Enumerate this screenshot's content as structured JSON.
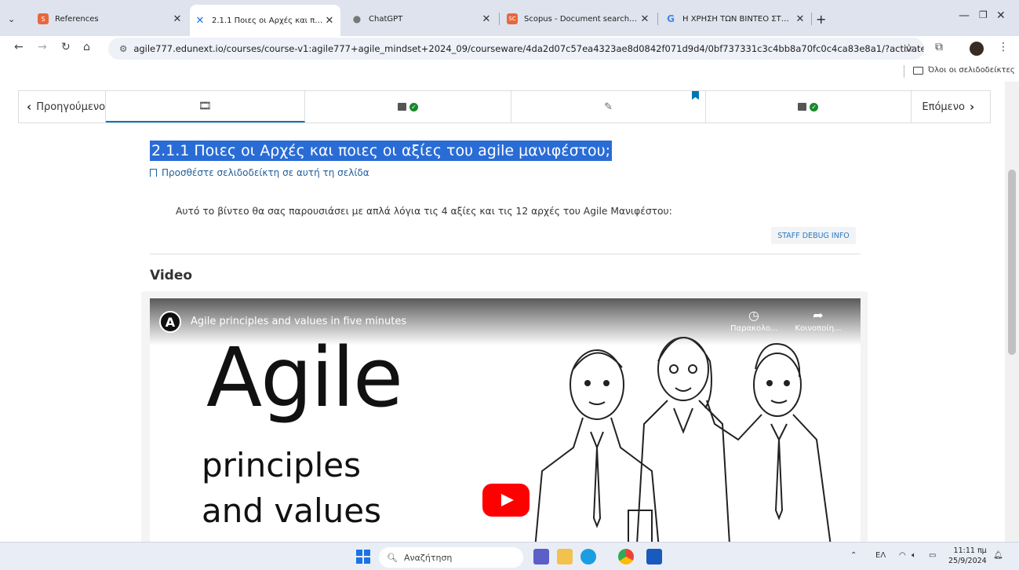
{
  "browser": {
    "tabs": [
      {
        "title": "References",
        "favicon_color": "#e8673c",
        "favicon_glyph": "S"
      },
      {
        "title": "2.1.1 Ποιες οι Αρχές και ποιες οι",
        "favicon_color": "#1a73e8",
        "favicon_glyph": "✕",
        "active": true
      },
      {
        "title": "ChatGPT",
        "favicon_color": "#777777",
        "favicon_glyph": "●"
      },
      {
        "title": "Scopus - Document search resu",
        "favicon_color": "#e8673c",
        "favicon_glyph": "SC"
      },
      {
        "title": "Η ΧΡΗΣΗ ΤΩΝ ΒΙΝΤΕΟ ΣΤΑ ΜΟ",
        "favicon_color": "#4285f4",
        "favicon_glyph": "G"
      }
    ],
    "new_tab": "+",
    "url": "agile777.edunext.io/courses/course-v1:agile777+agile_mindset+2024_09/courseware/4da2d07c57ea4323ae8d0842f071d9d4/0bf737331c3c4bb8a70fc0c4ca83e8a1/?activate_block_id=blo...",
    "bookmarks_label": "Όλοι οι σελιδοδείκτες"
  },
  "sequence": {
    "prev_label": "Προηγούμενο",
    "next_label": "Επόμενο"
  },
  "content": {
    "title": "2.1.1 Ποιες οι Αρχές και ποιες οι αξίες του agile μανιφέστου;",
    "bookmark_link": "Προσθέστε σελιδοδείκτη σε αυτή τη σελίδα",
    "description": "Αυτό το βίντεο θα σας παρουσιάσει με απλά λόγια τις 4 αξίες και τις 12 αρχές του Agile Μανιφέστου:",
    "debug_button": "STAFF DEBUG INFO",
    "video_heading": "Video"
  },
  "video": {
    "channel_initial": "A",
    "title": "Agile principles and values in five minutes",
    "watch_later": "Παρακολο...",
    "share": "Κοινοποίη...",
    "big_word": "Agile",
    "line1": "principles",
    "line2": "and values"
  },
  "taskbar": {
    "search_placeholder": "Αναζήτηση",
    "lang": "ΕΛ",
    "time": "11:11 πμ",
    "date": "25/9/2024"
  }
}
